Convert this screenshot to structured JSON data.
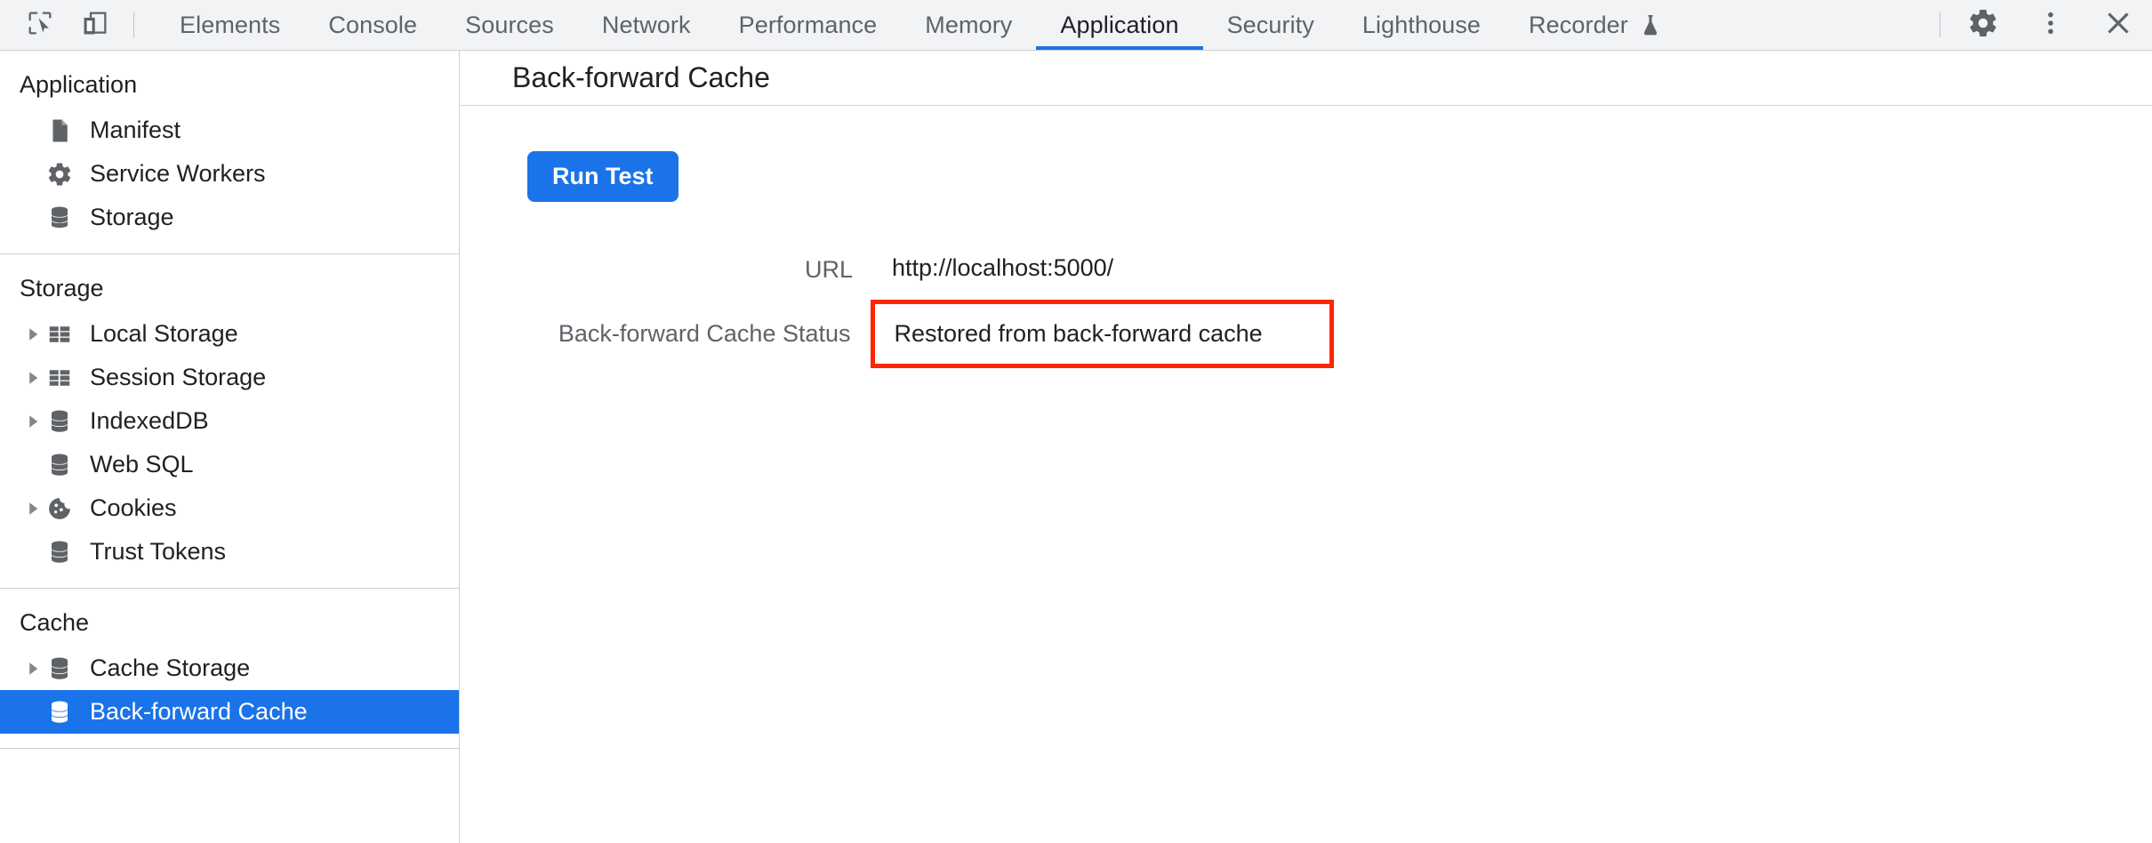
{
  "toolbar": {
    "left_icons": [
      {
        "name": "inspect-element-icon",
        "label": "Inspect element"
      },
      {
        "name": "device-toolbar-icon",
        "label": "Toggle device toolbar"
      }
    ],
    "tabs": [
      {
        "label": "Elements",
        "active": false
      },
      {
        "label": "Console",
        "active": false
      },
      {
        "label": "Sources",
        "active": false
      },
      {
        "label": "Network",
        "active": false
      },
      {
        "label": "Performance",
        "active": false
      },
      {
        "label": "Memory",
        "active": false
      },
      {
        "label": "Application",
        "active": true
      },
      {
        "label": "Security",
        "active": false
      },
      {
        "label": "Lighthouse",
        "active": false
      },
      {
        "label": "Recorder",
        "active": false,
        "badge_icon": "flask-icon"
      }
    ],
    "right_icons": [
      {
        "name": "settings-gear-icon",
        "label": "Settings"
      },
      {
        "name": "more-options-icon",
        "label": "Customize and control DevTools"
      },
      {
        "name": "close-icon",
        "label": "Close DevTools"
      }
    ],
    "active_tab_accent": "#1a73e8",
    "background": "#f1f3f4"
  },
  "sidebar": {
    "sections": [
      {
        "title": "Application",
        "items": [
          {
            "label": "Manifest",
            "icon": "manifest-document-icon",
            "expandable": false,
            "selected": false
          },
          {
            "label": "Service Workers",
            "icon": "gear-icon",
            "expandable": false,
            "selected": false
          },
          {
            "label": "Storage",
            "icon": "database-icon",
            "expandable": false,
            "selected": false
          }
        ]
      },
      {
        "title": "Storage",
        "items": [
          {
            "label": "Local Storage",
            "icon": "table-grid-icon",
            "expandable": true,
            "selected": false
          },
          {
            "label": "Session Storage",
            "icon": "table-grid-icon",
            "expandable": true,
            "selected": false
          },
          {
            "label": "IndexedDB",
            "icon": "database-icon",
            "expandable": true,
            "selected": false
          },
          {
            "label": "Web SQL",
            "icon": "database-icon",
            "expandable": false,
            "selected": false
          },
          {
            "label": "Cookies",
            "icon": "cookie-icon",
            "expandable": true,
            "selected": false
          },
          {
            "label": "Trust Tokens",
            "icon": "database-icon",
            "expandable": false,
            "selected": false
          }
        ]
      },
      {
        "title": "Cache",
        "items": [
          {
            "label": "Cache Storage",
            "icon": "database-icon",
            "expandable": true,
            "selected": false
          },
          {
            "label": "Back-forward Cache",
            "icon": "database-icon",
            "expandable": false,
            "selected": true
          }
        ]
      }
    ],
    "selected_background": "#1a73e8",
    "selected_text_color": "#ffffff"
  },
  "main": {
    "title": "Back-forward Cache",
    "run_test_label": "Run Test",
    "rows": [
      {
        "label": "URL",
        "value": "http://localhost:5000/",
        "highlighted": false
      },
      {
        "label": "Back-forward Cache Status",
        "value": "Restored from back-forward cache",
        "highlighted": true
      }
    ],
    "highlight_border_color": "#ff2600"
  }
}
